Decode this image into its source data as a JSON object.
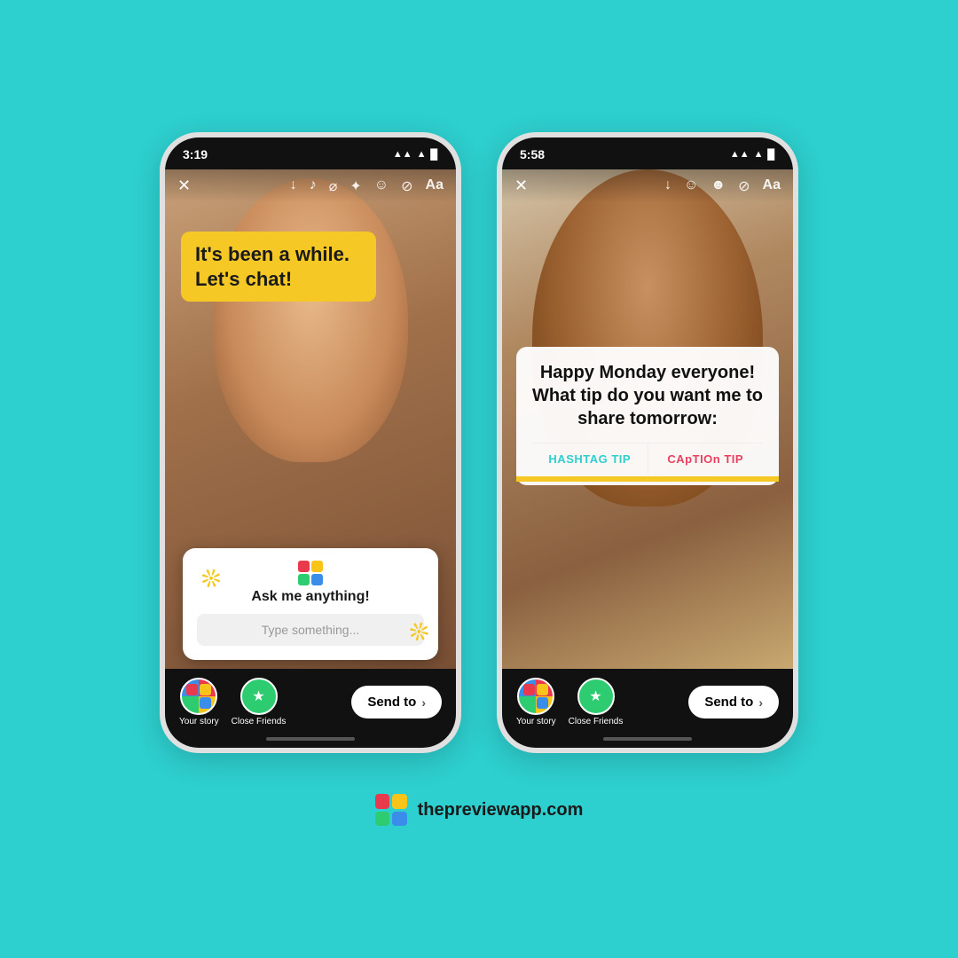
{
  "background_color": "#2ecfcf",
  "brand": {
    "logo_alt": "Preview App Logo",
    "url": "thepreviewapp.com"
  },
  "phone1": {
    "status_bar": {
      "time": "3:19",
      "icons": "▲▲ ▲ ▉"
    },
    "toolbar": {
      "close_icon": "✕",
      "icons": [
        "↓",
        "♪",
        "⌀",
        "✦",
        "☺",
        "⊘",
        "Aa"
      ]
    },
    "caption": {
      "text": "It's been a while. Let's chat!"
    },
    "widget": {
      "title": "Ask me anything!",
      "placeholder": "Type something..."
    },
    "bottom_bar": {
      "story_label": "Your story",
      "friends_label": "Close Friends",
      "send_label": "Send to",
      "send_chevron": "›"
    }
  },
  "phone2": {
    "status_bar": {
      "time": "5:58",
      "icons": "▲▲ ▲ ▉"
    },
    "toolbar": {
      "close_icon": "✕",
      "icons": [
        "↓",
        "☺",
        "☻",
        "⊘",
        "Aa"
      ]
    },
    "caption": {
      "text": "Happy Monday everyone! What tip do you want me to share tomorrow:"
    },
    "options": {
      "hashtag": "HASHTAG TIP",
      "caption": "CApTIOn TIP"
    },
    "bottom_bar": {
      "story_label": "Your story",
      "friends_label": "Close Friends",
      "send_label": "Send to",
      "send_chevron": "›"
    }
  }
}
